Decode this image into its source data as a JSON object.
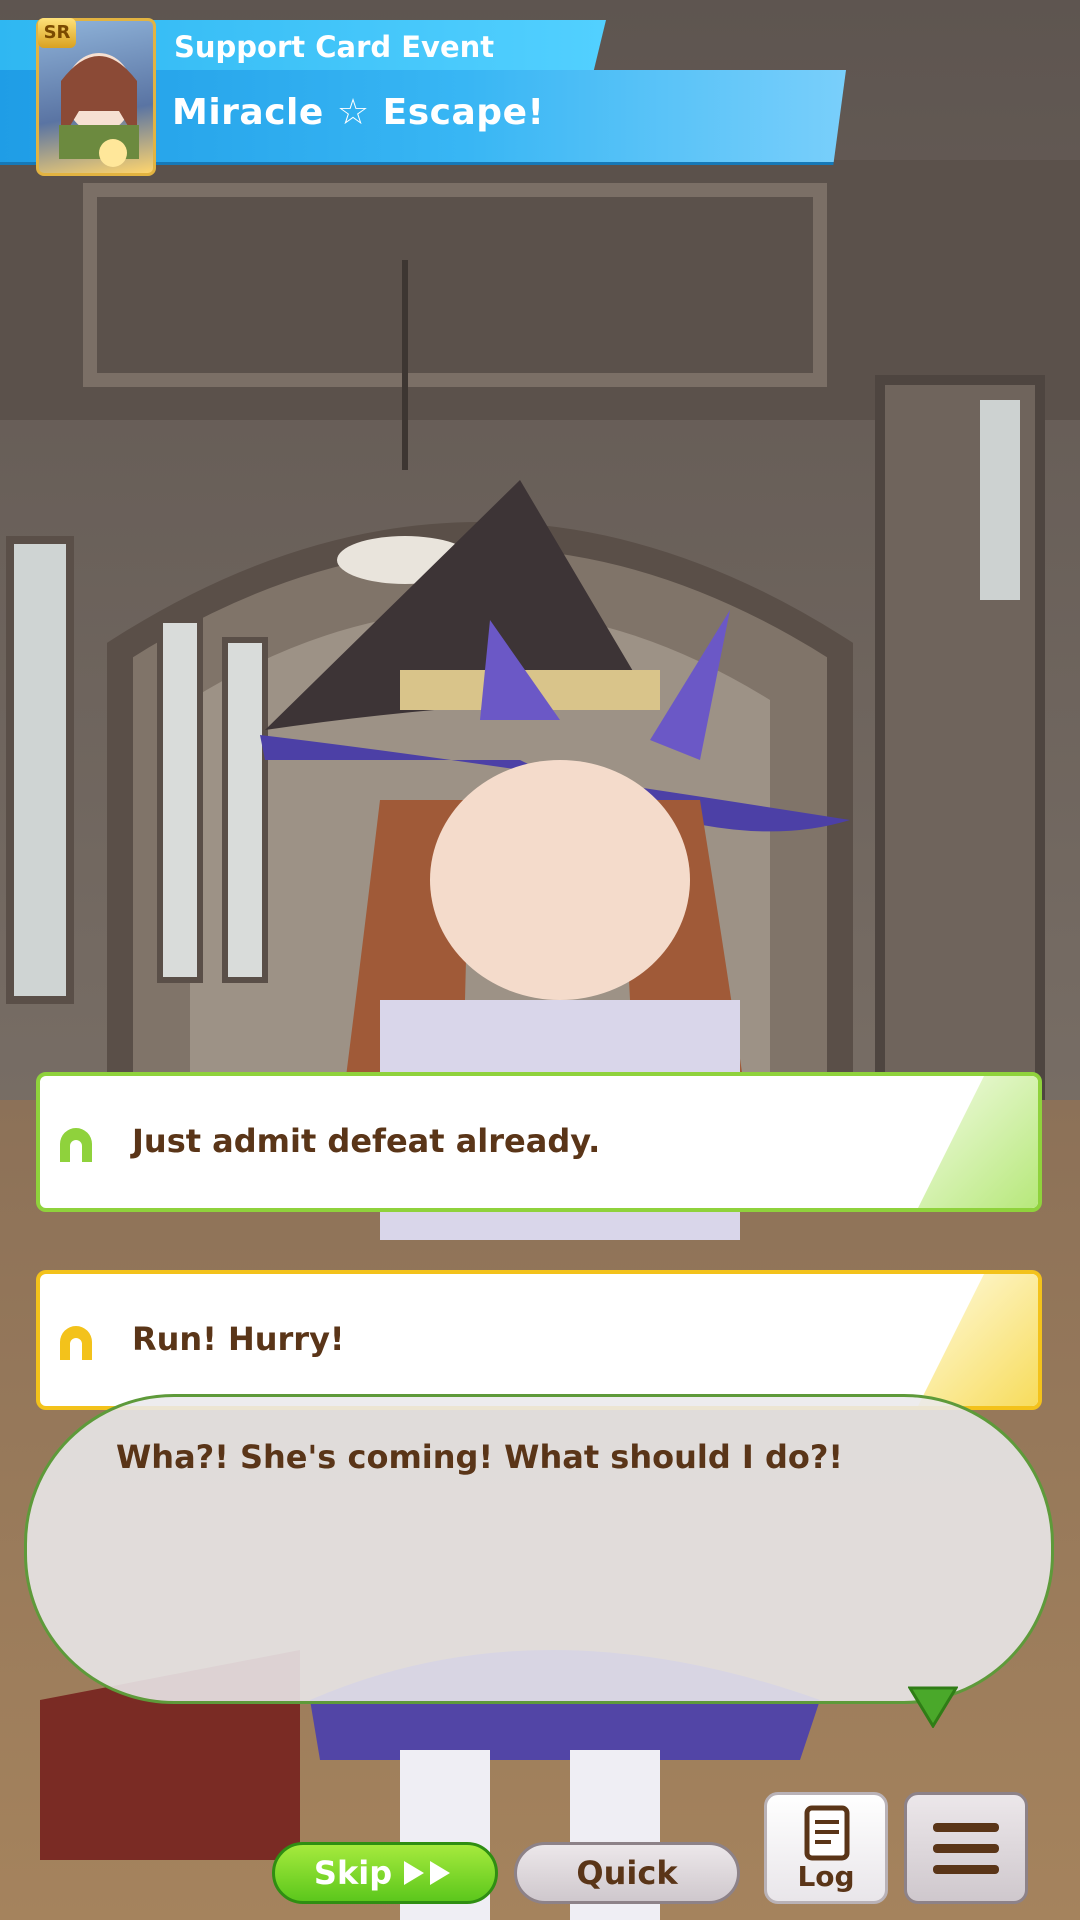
{
  "event": {
    "type_label": "Support Card Event",
    "title": "Miracle ☆ Escape!",
    "card_rarity": "SR"
  },
  "choices": [
    {
      "label": "Just admit defeat already.",
      "color": "#8fd23c",
      "icon": "horseshoe-icon"
    },
    {
      "label": "Run! Hurry!",
      "color": "#f3c21b",
      "icon": "horseshoe-icon"
    }
  ],
  "dialogue": {
    "text": "Wha?! She's coming! What should I do?!"
  },
  "controls": {
    "skip_label": "Skip",
    "quick_label": "Quick",
    "log_label": "Log"
  },
  "colors": {
    "accent_blue": "#2fb7f2",
    "skip_green": "#5cc71c",
    "text_brown": "#5a3518"
  }
}
